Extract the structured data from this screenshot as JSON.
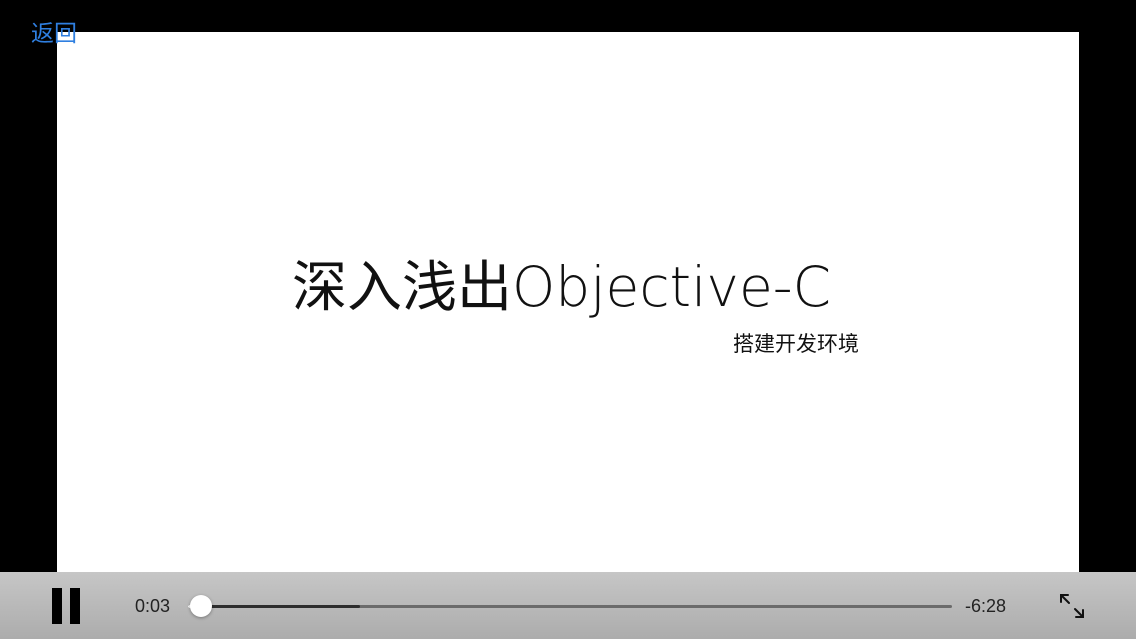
{
  "nav": {
    "back_label": "返回"
  },
  "slide": {
    "title": "深入浅出Objective-C",
    "subtitle": "搭建开发环境"
  },
  "player": {
    "elapsed": "0:03",
    "remaining": "-6:28",
    "progress_fraction": 0.008,
    "buffered_fraction": 0.225,
    "state": "playing"
  },
  "icons": {
    "pause": "pause-icon",
    "fullscreen": "fullscreen-expand-icon"
  },
  "colors": {
    "back_link": "#2f7fe0",
    "control_bar": "#bcbcbc",
    "video_background": "#ffffff",
    "letterbox": "#000000"
  }
}
